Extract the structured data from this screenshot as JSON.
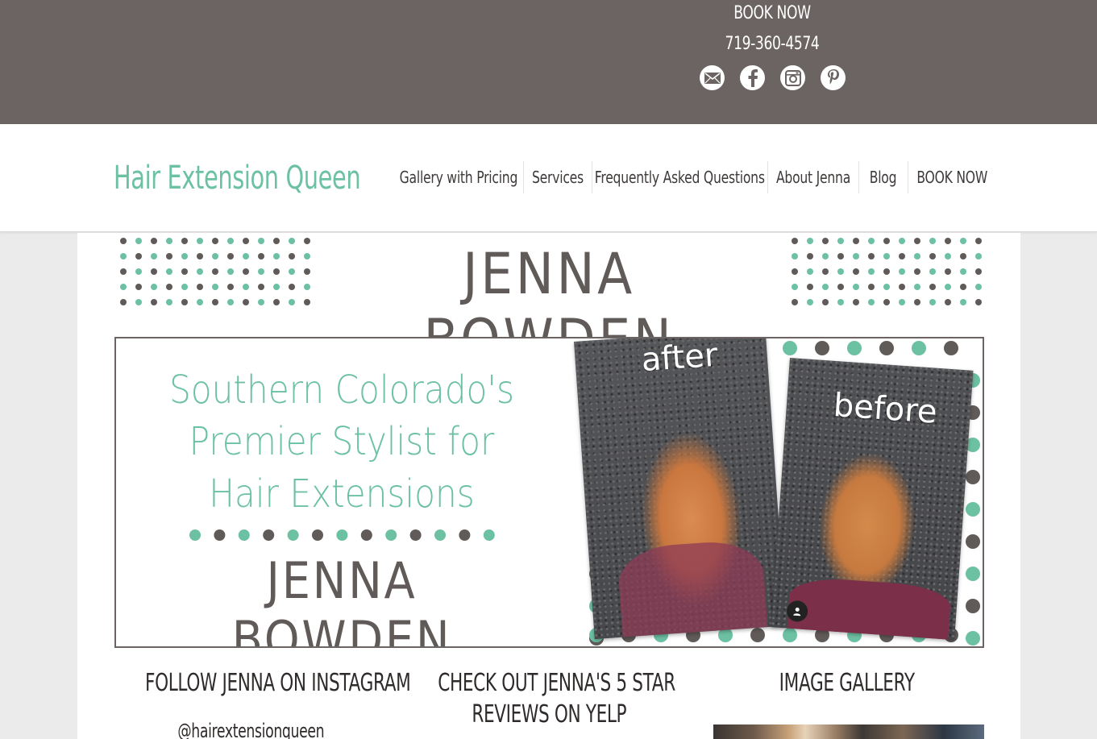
{
  "topbar": {
    "book_now": "BOOK NOW",
    "phone": "719-360-4574",
    "social_icons": [
      "email-icon",
      "facebook-icon",
      "instagram-icon",
      "pinterest-icon"
    ]
  },
  "header": {
    "site_title": "Hair Extension Queen",
    "nav": [
      "Gallery with Pricing",
      "Services",
      "Frequently Asked Questions",
      "About Jenna",
      "Blog",
      "BOOK NOW"
    ]
  },
  "banner": {
    "name": "JENNA BOWDEN"
  },
  "hero": {
    "tagline": [
      "Southern Colorado's",
      "Premier Stylist for",
      "Hair Extensions"
    ],
    "name": "JENNA BOWDEN",
    "after_label": "after",
    "before_label": "before"
  },
  "columns": {
    "instagram_title": "FOLLOW JENNA ON INSTAGRAM",
    "instagram_handle": "@hairextensionqueen",
    "yelp_title_1": "CHECK OUT JENNA'S 5 STAR",
    "yelp_title_2": "REVIEWS ON YELP",
    "gallery_title": "IMAGE GALLERY"
  },
  "colors": {
    "topbar": "#6b6462",
    "accent_mint": "#6dc1a3",
    "dark_gray": "#605a58"
  }
}
